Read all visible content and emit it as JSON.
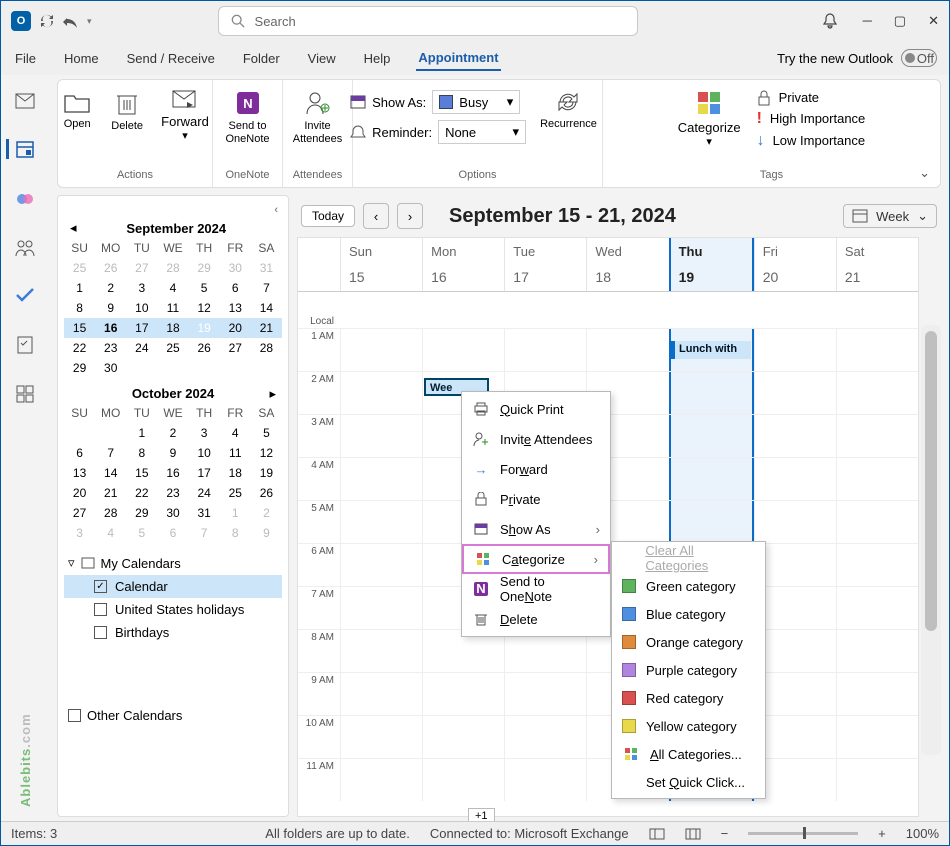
{
  "titlebar": {
    "search_placeholder": "Search"
  },
  "menubar": {
    "file": "File",
    "home": "Home",
    "sendreceive": "Send / Receive",
    "folder": "Folder",
    "view": "View",
    "help": "Help",
    "appointment": "Appointment",
    "try_new": "Try the new Outlook",
    "toggle_off": "Off"
  },
  "ribbon": {
    "open": "Open",
    "delete": "Delete",
    "forward": "Forward",
    "send_onenote": "Send to\nOneNote",
    "invite_attendees": "Invite\nAttendees",
    "show_as": "Show As:",
    "show_as_value": "Busy",
    "reminder": "Reminder:",
    "reminder_value": "None",
    "recurrence": "Recurrence",
    "categorize": "Categorize",
    "private": "Private",
    "high_imp": "High Importance",
    "low_imp": "Low Importance",
    "grp_actions": "Actions",
    "grp_onenote": "OneNote",
    "grp_attendees": "Attendees",
    "grp_options": "Options",
    "grp_tags": "Tags"
  },
  "sidebar": {
    "month1_title": "September 2024",
    "month2_title": "October 2024",
    "dow": [
      "SU",
      "MO",
      "TU",
      "WE",
      "TH",
      "FR",
      "SA"
    ],
    "sept_rows": [
      [
        "25",
        "26",
        "27",
        "28",
        "29",
        "30",
        "31"
      ],
      [
        "1",
        "2",
        "3",
        "4",
        "5",
        "6",
        "7"
      ],
      [
        "8",
        "9",
        "10",
        "11",
        "12",
        "13",
        "14"
      ],
      [
        "15",
        "16",
        "17",
        "18",
        "19",
        "20",
        "21"
      ],
      [
        "22",
        "23",
        "24",
        "25",
        "26",
        "27",
        "28"
      ],
      [
        "29",
        "30",
        "",
        "",
        "",
        "",
        ""
      ]
    ],
    "oct_rows": [
      [
        "",
        "",
        "1",
        "2",
        "3",
        "4",
        "5"
      ],
      [
        "6",
        "7",
        "8",
        "9",
        "10",
        "11",
        "12"
      ],
      [
        "13",
        "14",
        "15",
        "16",
        "17",
        "18",
        "19"
      ],
      [
        "20",
        "21",
        "22",
        "23",
        "24",
        "25",
        "26"
      ],
      [
        "27",
        "28",
        "29",
        "30",
        "31",
        "1",
        "2"
      ],
      [
        "3",
        "4",
        "5",
        "6",
        "7",
        "8",
        "9"
      ]
    ],
    "mycals": "My Calendars",
    "cal1": "Calendar",
    "cal2": "United States holidays",
    "cal3": "Birthdays",
    "othercals": "Other Calendars"
  },
  "main": {
    "today": "Today",
    "range": "September 15 - 21, 2024",
    "week": "Week",
    "days": [
      "Sun",
      "Mon",
      "Tue",
      "Wed",
      "Thu",
      "Fri",
      "Sat"
    ],
    "nums": [
      "15",
      "16",
      "17",
      "18",
      "19",
      "20",
      "21"
    ],
    "hours": [
      "1 AM",
      "2 AM",
      "3 AM",
      "4 AM",
      "5 AM",
      "6 AM",
      "7 AM",
      "8 AM",
      "9 AM",
      "10 AM",
      "11 AM"
    ],
    "local": "Local",
    "event1": "Wee",
    "event2": "Lunch with",
    "plus": "+1"
  },
  "ctx": {
    "quick_print": "Quick Print",
    "invite": "Invite Attendees",
    "forward": "Forward",
    "private": "Private",
    "show_as": "Show As",
    "categorize": "Categorize",
    "onenote": "Send to OneNote",
    "delete": "Delete"
  },
  "sub": {
    "clear": "Clear All Categories",
    "green": "Green category",
    "blue": "Blue category",
    "orange": "Orange category",
    "purple": "Purple category",
    "red": "Red category",
    "yellow": "Yellow category",
    "all": "All Categories...",
    "quick": "Set Quick Click..."
  },
  "status": {
    "items": "Items: 3",
    "folders": "All folders are up to date.",
    "connected": "Connected to: Microsoft Exchange",
    "zoom": "100%"
  },
  "watermark": "Ablebits",
  "watermark_suffix": ".com",
  "colors": {
    "green": "#5fb35f",
    "blue": "#4f8fe0",
    "orange": "#e08a3c",
    "purple": "#b085e0",
    "red": "#d85050",
    "yellow": "#e8d84c"
  }
}
